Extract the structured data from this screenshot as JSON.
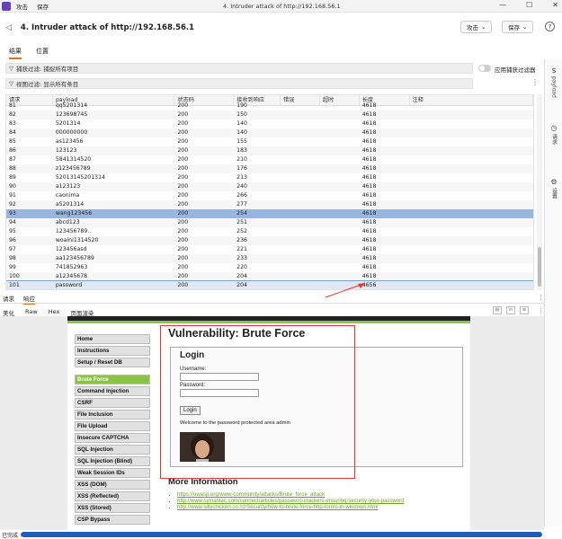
{
  "titlebar": {
    "menu": [
      "攻击",
      "保存"
    ],
    "title": "4. Intruder attack of http://192.168.56.1",
    "controls": [
      "—",
      "☐",
      "✕"
    ]
  },
  "header": {
    "title": "4. Intruder attack of http://192.168.56.1",
    "attack_btn": "攻击",
    "save_btn": "保存"
  },
  "tabs": [
    "结果",
    "位置"
  ],
  "filters": {
    "capture": "捕获过滤: 捕捉所有项目",
    "view": "视图过滤: 显示所有条目",
    "apply_label": "应用捕获过滤器"
  },
  "side_panel": [
    "payload",
    "请求",
    "设置"
  ],
  "table": {
    "headers": [
      "请求",
      "payload",
      "状态码",
      "接收到响应",
      "错误",
      "超时",
      "长度",
      "注释"
    ],
    "rows": [
      [
        "81",
        "qq5201314",
        "200",
        "190",
        "",
        "",
        "4618",
        ""
      ],
      [
        "82",
        "123698745",
        "200",
        "150",
        "",
        "",
        "4618",
        ""
      ],
      [
        "83",
        "5201314",
        "200",
        "140",
        "",
        "",
        "4618",
        ""
      ],
      [
        "84",
        "000000000",
        "200",
        "140",
        "",
        "",
        "4618",
        ""
      ],
      [
        "85",
        "as123456",
        "200",
        "155",
        "",
        "",
        "4618",
        ""
      ],
      [
        "86",
        "123123",
        "200",
        "183",
        "",
        "",
        "4618",
        ""
      ],
      [
        "87",
        "5841314520",
        "200",
        "210",
        "",
        "",
        "4618",
        ""
      ],
      [
        "88",
        "z123456789",
        "200",
        "176",
        "",
        "",
        "4618",
        ""
      ],
      [
        "89",
        "52013145201314",
        "200",
        "213",
        "",
        "",
        "4618",
        ""
      ],
      [
        "90",
        "a123123",
        "200",
        "240",
        "",
        "",
        "4618",
        ""
      ],
      [
        "91",
        "caonima",
        "200",
        "266",
        "",
        "",
        "4618",
        ""
      ],
      [
        "92",
        "a5201314",
        "200",
        "277",
        "",
        "",
        "4618",
        ""
      ],
      [
        "93",
        "wang123456",
        "200",
        "254",
        "",
        "",
        "4618",
        ""
      ],
      [
        "94",
        "abcd123",
        "200",
        "251",
        "",
        "",
        "4618",
        ""
      ],
      [
        "95",
        "123456789..",
        "200",
        "252",
        "",
        "",
        "4618",
        ""
      ],
      [
        "96",
        "woaini1314520",
        "200",
        "236",
        "",
        "",
        "4618",
        ""
      ],
      [
        "97",
        "123456asd",
        "200",
        "221",
        "",
        "",
        "4618",
        ""
      ],
      [
        "98",
        "aa123456789",
        "200",
        "233",
        "",
        "",
        "4618",
        ""
      ],
      [
        "99",
        "741852963",
        "200",
        "220",
        "",
        "",
        "4618",
        ""
      ],
      [
        "100",
        "a12345678",
        "200",
        "204",
        "",
        "",
        "4618",
        ""
      ],
      [
        "101",
        "password",
        "200",
        "204",
        "",
        "",
        "4656",
        ""
      ]
    ]
  },
  "req_resp_tabs": [
    "请求",
    "响应"
  ],
  "view_tabs": [
    "美化",
    "Raw",
    "Hex",
    "页面渲染"
  ],
  "view_icons": [
    "▤",
    "\\n",
    "≡"
  ],
  "dvwa": {
    "nav": [
      "Home",
      "Instructions",
      "Setup / Reset DB",
      "Brute Force",
      "Command Injection",
      "CSRF",
      "File Inclusion",
      "File Upload",
      "Insecure CAPTCHA",
      "SQL Injection",
      "SQL Injection (Blind)",
      "Weak Session IDs",
      "XSS (DOM)",
      "XSS (Reflected)",
      "XSS (Stored)",
      "CSP Bypass"
    ],
    "title": "Vulnerability: Brute Force",
    "login_heading": "Login",
    "username_label": "Username:",
    "password_label": "Password:",
    "login_button": "Login",
    "welcome": "Welcome to the password protected area admin",
    "more_info": "More Information",
    "links": [
      "https://owasp.org/www-community/attacks/Brute_force_attack",
      "http://www.symantec.com/connect/articles/password-crackers-ensuring-security-your-password",
      "http://www.sillychicken.co.nz/Security/how-to-brute-force-http-forms-in-windows.html"
    ]
  },
  "status": {
    "text": "已完成",
    "progress": 1.0
  },
  "colors": {
    "accent": "#e07020",
    "selected_row": "#97b6e0",
    "dvwa_green": "#8bc34a",
    "highlight_red": "#e53935",
    "progress": "#1e5eb8"
  }
}
